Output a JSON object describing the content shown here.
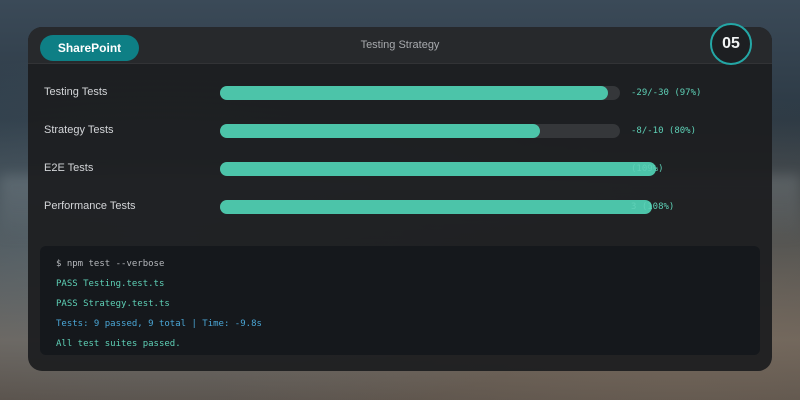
{
  "header": {
    "brand": "SharePoint",
    "title": "Testing Strategy",
    "step_number": "05"
  },
  "rows": [
    {
      "label": "Testing Tests",
      "result": "-29/-30 (97%)",
      "progress": 0.97
    },
    {
      "label": "Strategy Tests",
      "result": "-8/-10 (80%)",
      "progress": 0.8
    },
    {
      "label": "E2E Tests",
      "result": "(109%)",
      "progress": 1.09
    },
    {
      "label": "Performance Tests",
      "result": "3 (108%)",
      "progress": 1.08
    }
  ],
  "terminal": {
    "command": "$ npm test --verbose",
    "pass_1": "PASS Testing.test.ts",
    "pass_2": "PASS Strategy.test.ts",
    "summary": "Tests: 9 passed, 9 total | Time: -9.8s",
    "done": "All test suites passed."
  },
  "colors": {
    "accent": "#4cc4a9",
    "brand": "#0e7f85",
    "badge_ring": "#24a7a6",
    "summary_text": "#4aa6d6"
  }
}
